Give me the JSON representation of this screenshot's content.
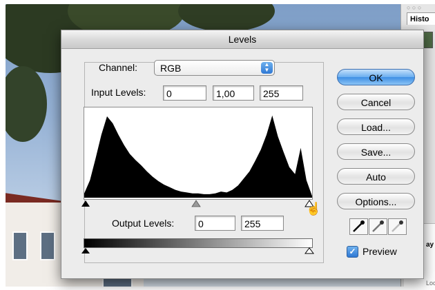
{
  "dialog": {
    "title": "Levels",
    "channel_label": "Channel:",
    "channel_value": "RGB",
    "input_levels_label": "Input Levels:",
    "input_levels": [
      "0",
      "1,00",
      "255"
    ],
    "output_levels_label": "Output Levels:",
    "output_levels": [
      "0",
      "255"
    ],
    "preview_label": "Preview",
    "preview_checked": true
  },
  "buttons": {
    "ok": "OK",
    "cancel": "Cancel",
    "load": "Load...",
    "save": "Save...",
    "auto": "Auto",
    "options": "Options..."
  },
  "side_panel": {
    "tab_label": "Histo",
    "fragment_1": "ay",
    "fragment_2": "Lock"
  },
  "histogram": {
    "channel": "RGB",
    "values": [
      0.05,
      0.2,
      0.45,
      0.72,
      0.93,
      0.85,
      0.72,
      0.6,
      0.5,
      0.43,
      0.37,
      0.3,
      0.24,
      0.19,
      0.15,
      0.12,
      0.09,
      0.07,
      0.06,
      0.05,
      0.05,
      0.04,
      0.04,
      0.05,
      0.07,
      0.06,
      0.09,
      0.14,
      0.22,
      0.3,
      0.42,
      0.55,
      0.72,
      0.94,
      0.7,
      0.52,
      0.35,
      0.27,
      0.57,
      0.2,
      0.02
    ]
  },
  "colors": {
    "accent": "#3f8fe4",
    "dialog_bg": "#ececec"
  }
}
